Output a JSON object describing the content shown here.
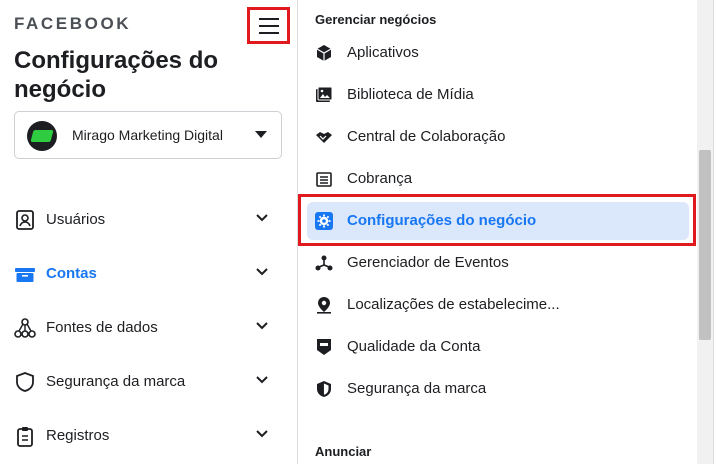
{
  "left_panel": {
    "brand": "FACEBOOK",
    "title": "Configurações do negócio",
    "account": {
      "name": "Mirago Marketing Digital"
    },
    "nav": [
      {
        "label": "Usuários",
        "icon": "user-badge-icon",
        "active": false
      },
      {
        "label": "Contas",
        "icon": "folder-icon",
        "active": true
      },
      {
        "label": "Fontes de dados",
        "icon": "data-sources-icon",
        "active": false
      },
      {
        "label": "Segurança da marca",
        "icon": "shield-icon",
        "active": false
      },
      {
        "label": "Registros",
        "icon": "clipboard-icon",
        "active": false
      }
    ]
  },
  "menu": {
    "section1": "Gerenciar negócios",
    "items": [
      {
        "label": "Aplicativos",
        "icon": "cube-icon"
      },
      {
        "label": "Biblioteca de Mídia",
        "icon": "media-library-icon"
      },
      {
        "label": "Central de Colaboração",
        "icon": "handshake-icon"
      },
      {
        "label": "Cobrança",
        "icon": "billing-icon"
      },
      {
        "label": "Configurações do negócio",
        "icon": "gear-icon",
        "selected": true
      },
      {
        "label": "Gerenciador de Eventos",
        "icon": "events-icon"
      },
      {
        "label": "Localizações de estabelecime...",
        "icon": "location-pin-icon"
      },
      {
        "label": "Qualidade da Conta",
        "icon": "account-quality-icon"
      },
      {
        "label": "Segurança da marca",
        "icon": "shield-icon"
      }
    ],
    "section2": "Anunciar"
  },
  "colors": {
    "accent": "#1877f2",
    "highlight_border": "#e0191e",
    "selected_bg": "#dbe7fb"
  }
}
